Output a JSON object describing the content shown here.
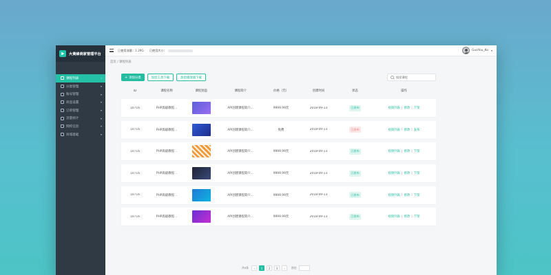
{
  "brand": {
    "title": "大黄蜂商家管理平台"
  },
  "sidebar": {
    "items": [
      {
        "label": "课程列表",
        "active": true,
        "arrow": "›"
      },
      {
        "label": "分类管理",
        "active": false,
        "arrow": "▾"
      },
      {
        "label": "账号管理",
        "active": false,
        "arrow": "▾"
      },
      {
        "label": "商品设置",
        "active": false,
        "arrow": "▾"
      },
      {
        "label": "订单管理",
        "active": false,
        "arrow": "▾"
      },
      {
        "label": "流量统计",
        "active": false,
        "arrow": "▾"
      },
      {
        "label": "网校信息",
        "active": false,
        "arrow": "▾"
      },
      {
        "label": "商城基础",
        "active": false,
        "arrow": "▾"
      }
    ]
  },
  "topbar": {
    "traffic_label": "已使用流量：",
    "traffic_value": "1.29G",
    "storage_label": "已使用大小：",
    "storage_percent": 60,
    "username": "GuoYou_Ko",
    "caret": "▾"
  },
  "breadcrumb": "首页 / 课程列表",
  "toolbar": {
    "add_icon": "+",
    "add_label": "添加分类",
    "download_tool_label": "加密工具下载",
    "download_player_label": "加密播放器下载"
  },
  "search": {
    "placeholder": "搜索课程"
  },
  "table": {
    "headers": [
      "ID",
      "课程名称",
      "课程封面",
      "课程简介",
      "价格（元）",
      "创建时间",
      "状态",
      "操作"
    ],
    "op_labels": {
      "video": "视频列表",
      "edit": "修改",
      "action_sep": "|"
    },
    "rows": [
      {
        "id": "10716",
        "name": "PHP高级教程...",
        "intro": "API创建课程简介...",
        "price": "9999.99元",
        "date": "2018-09-13",
        "status": "已发布",
        "published": true,
        "third_op": "下架",
        "cover_color": "#5b5fdc"
      },
      {
        "id": "10716",
        "name": "PHP高级教程...",
        "intro": "API创建课程简介...",
        "price": "免费",
        "date": "2018-09-13",
        "status": "已发布",
        "published": false,
        "third_op": "发布",
        "cover_color": "#2f5bd8"
      },
      {
        "id": "10716",
        "name": "PHP高级教程...",
        "intro": "API创建课程简介...",
        "price": "9999.99元",
        "date": "2018-09-13",
        "status": "已发布",
        "published": true,
        "third_op": "下架",
        "cover_color": "#f39a3a"
      },
      {
        "id": "10716",
        "name": "PHP高级教程...",
        "intro": "API创建课程简介...",
        "price": "9999.99元",
        "date": "2018-09-13",
        "status": "已发布",
        "published": true,
        "third_op": "下架",
        "cover_color": "#1e2235"
      },
      {
        "id": "10716",
        "name": "PHP高级教程...",
        "intro": "API创建课程简介...",
        "price": "9999.99元",
        "date": "2018-09-13",
        "status": "已发布",
        "published": true,
        "third_op": "下架",
        "cover_color": "#1f7ad6"
      },
      {
        "id": "10716",
        "name": "PHP高级教程...",
        "intro": "API创建课程简介...",
        "price": "9999.99元",
        "date": "2018-09-13",
        "status": "已发布",
        "published": true,
        "third_op": "下架",
        "cover_color": "#6a2fd6"
      }
    ]
  },
  "pager": {
    "total_label": "共6条",
    "prev": "‹",
    "pages": [
      "1",
      "2",
      "3"
    ],
    "current": "1",
    "next": "›",
    "goto_label": "前往"
  }
}
